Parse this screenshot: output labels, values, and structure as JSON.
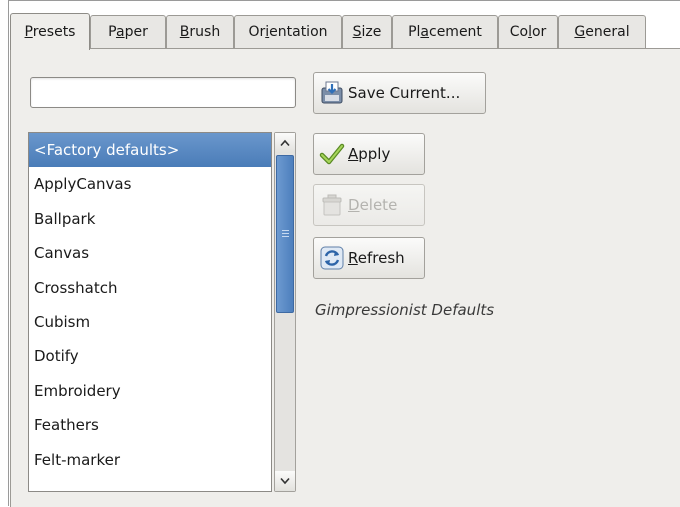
{
  "tabs": [
    {
      "pre": "",
      "u": "P",
      "post": "resets"
    },
    {
      "pre": "P",
      "u": "a",
      "post": "per"
    },
    {
      "pre": "",
      "u": "B",
      "post": "rush"
    },
    {
      "pre": "Or",
      "u": "i",
      "post": "entation"
    },
    {
      "pre": "",
      "u": "S",
      "post": "ize"
    },
    {
      "pre": "Pl",
      "u": "a",
      "post": "cement"
    },
    {
      "pre": "Co",
      "u": "l",
      "post": "or"
    },
    {
      "pre": "",
      "u": "G",
      "post": "eneral"
    }
  ],
  "preset_name": {
    "value": ""
  },
  "buttons": {
    "save": {
      "pre": "Save Current...",
      "u": "",
      "post": ""
    },
    "apply": {
      "pre": "",
      "u": "A",
      "post": "pply"
    },
    "delete": {
      "pre": "",
      "u": "D",
      "post": "elete"
    },
    "refresh": {
      "pre": "",
      "u": "R",
      "post": "efresh"
    }
  },
  "presets": [
    "<Factory defaults>",
    "ApplyCanvas",
    "Ballpark",
    "Canvas",
    "Crosshatch",
    "Cubism",
    "Dotify",
    "Embroidery",
    "Feathers",
    "Felt-marker"
  ],
  "selected_index": 0,
  "scrollbar": {
    "position_fraction": 0.0,
    "visible_fraction": 0.48
  },
  "description": "Gimpressionist Defaults",
  "icons": {
    "save": "save-disk-icon",
    "apply": "checkmark-icon",
    "delete": "trash-icon",
    "refresh": "refresh-icon"
  },
  "colors": {
    "selection": "#4a7cb8",
    "panel": "#efeeeb",
    "disabled_text": "#b4b3af"
  }
}
